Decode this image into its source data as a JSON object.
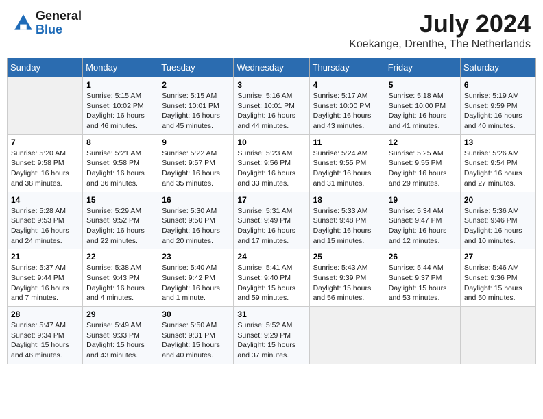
{
  "header": {
    "logo_general": "General",
    "logo_blue": "Blue",
    "month_title": "July 2024",
    "location": "Koekange, Drenthe, The Netherlands"
  },
  "weekdays": [
    "Sunday",
    "Monday",
    "Tuesday",
    "Wednesday",
    "Thursday",
    "Friday",
    "Saturday"
  ],
  "weeks": [
    [
      {
        "day": "",
        "sunrise": "",
        "sunset": "",
        "daylight": ""
      },
      {
        "day": "1",
        "sunrise": "Sunrise: 5:15 AM",
        "sunset": "Sunset: 10:02 PM",
        "daylight": "Daylight: 16 hours and 46 minutes."
      },
      {
        "day": "2",
        "sunrise": "Sunrise: 5:15 AM",
        "sunset": "Sunset: 10:01 PM",
        "daylight": "Daylight: 16 hours and 45 minutes."
      },
      {
        "day": "3",
        "sunrise": "Sunrise: 5:16 AM",
        "sunset": "Sunset: 10:01 PM",
        "daylight": "Daylight: 16 hours and 44 minutes."
      },
      {
        "day": "4",
        "sunrise": "Sunrise: 5:17 AM",
        "sunset": "Sunset: 10:00 PM",
        "daylight": "Daylight: 16 hours and 43 minutes."
      },
      {
        "day": "5",
        "sunrise": "Sunrise: 5:18 AM",
        "sunset": "Sunset: 10:00 PM",
        "daylight": "Daylight: 16 hours and 41 minutes."
      },
      {
        "day": "6",
        "sunrise": "Sunrise: 5:19 AM",
        "sunset": "Sunset: 9:59 PM",
        "daylight": "Daylight: 16 hours and 40 minutes."
      }
    ],
    [
      {
        "day": "7",
        "sunrise": "Sunrise: 5:20 AM",
        "sunset": "Sunset: 9:58 PM",
        "daylight": "Daylight: 16 hours and 38 minutes."
      },
      {
        "day": "8",
        "sunrise": "Sunrise: 5:21 AM",
        "sunset": "Sunset: 9:58 PM",
        "daylight": "Daylight: 16 hours and 36 minutes."
      },
      {
        "day": "9",
        "sunrise": "Sunrise: 5:22 AM",
        "sunset": "Sunset: 9:57 PM",
        "daylight": "Daylight: 16 hours and 35 minutes."
      },
      {
        "day": "10",
        "sunrise": "Sunrise: 5:23 AM",
        "sunset": "Sunset: 9:56 PM",
        "daylight": "Daylight: 16 hours and 33 minutes."
      },
      {
        "day": "11",
        "sunrise": "Sunrise: 5:24 AM",
        "sunset": "Sunset: 9:55 PM",
        "daylight": "Daylight: 16 hours and 31 minutes."
      },
      {
        "day": "12",
        "sunrise": "Sunrise: 5:25 AM",
        "sunset": "Sunset: 9:55 PM",
        "daylight": "Daylight: 16 hours and 29 minutes."
      },
      {
        "day": "13",
        "sunrise": "Sunrise: 5:26 AM",
        "sunset": "Sunset: 9:54 PM",
        "daylight": "Daylight: 16 hours and 27 minutes."
      }
    ],
    [
      {
        "day": "14",
        "sunrise": "Sunrise: 5:28 AM",
        "sunset": "Sunset: 9:53 PM",
        "daylight": "Daylight: 16 hours and 24 minutes."
      },
      {
        "day": "15",
        "sunrise": "Sunrise: 5:29 AM",
        "sunset": "Sunset: 9:52 PM",
        "daylight": "Daylight: 16 hours and 22 minutes."
      },
      {
        "day": "16",
        "sunrise": "Sunrise: 5:30 AM",
        "sunset": "Sunset: 9:50 PM",
        "daylight": "Daylight: 16 hours and 20 minutes."
      },
      {
        "day": "17",
        "sunrise": "Sunrise: 5:31 AM",
        "sunset": "Sunset: 9:49 PM",
        "daylight": "Daylight: 16 hours and 17 minutes."
      },
      {
        "day": "18",
        "sunrise": "Sunrise: 5:33 AM",
        "sunset": "Sunset: 9:48 PM",
        "daylight": "Daylight: 16 hours and 15 minutes."
      },
      {
        "day": "19",
        "sunrise": "Sunrise: 5:34 AM",
        "sunset": "Sunset: 9:47 PM",
        "daylight": "Daylight: 16 hours and 12 minutes."
      },
      {
        "day": "20",
        "sunrise": "Sunrise: 5:36 AM",
        "sunset": "Sunset: 9:46 PM",
        "daylight": "Daylight: 16 hours and 10 minutes."
      }
    ],
    [
      {
        "day": "21",
        "sunrise": "Sunrise: 5:37 AM",
        "sunset": "Sunset: 9:44 PM",
        "daylight": "Daylight: 16 hours and 7 minutes."
      },
      {
        "day": "22",
        "sunrise": "Sunrise: 5:38 AM",
        "sunset": "Sunset: 9:43 PM",
        "daylight": "Daylight: 16 hours and 4 minutes."
      },
      {
        "day": "23",
        "sunrise": "Sunrise: 5:40 AM",
        "sunset": "Sunset: 9:42 PM",
        "daylight": "Daylight: 16 hours and 1 minute."
      },
      {
        "day": "24",
        "sunrise": "Sunrise: 5:41 AM",
        "sunset": "Sunset: 9:40 PM",
        "daylight": "Daylight: 15 hours and 59 minutes."
      },
      {
        "day": "25",
        "sunrise": "Sunrise: 5:43 AM",
        "sunset": "Sunset: 9:39 PM",
        "daylight": "Daylight: 15 hours and 56 minutes."
      },
      {
        "day": "26",
        "sunrise": "Sunrise: 5:44 AM",
        "sunset": "Sunset: 9:37 PM",
        "daylight": "Daylight: 15 hours and 53 minutes."
      },
      {
        "day": "27",
        "sunrise": "Sunrise: 5:46 AM",
        "sunset": "Sunset: 9:36 PM",
        "daylight": "Daylight: 15 hours and 50 minutes."
      }
    ],
    [
      {
        "day": "28",
        "sunrise": "Sunrise: 5:47 AM",
        "sunset": "Sunset: 9:34 PM",
        "daylight": "Daylight: 15 hours and 46 minutes."
      },
      {
        "day": "29",
        "sunrise": "Sunrise: 5:49 AM",
        "sunset": "Sunset: 9:33 PM",
        "daylight": "Daylight: 15 hours and 43 minutes."
      },
      {
        "day": "30",
        "sunrise": "Sunrise: 5:50 AM",
        "sunset": "Sunset: 9:31 PM",
        "daylight": "Daylight: 15 hours and 40 minutes."
      },
      {
        "day": "31",
        "sunrise": "Sunrise: 5:52 AM",
        "sunset": "Sunset: 9:29 PM",
        "daylight": "Daylight: 15 hours and 37 minutes."
      },
      {
        "day": "",
        "sunrise": "",
        "sunset": "",
        "daylight": ""
      },
      {
        "day": "",
        "sunrise": "",
        "sunset": "",
        "daylight": ""
      },
      {
        "day": "",
        "sunrise": "",
        "sunset": "",
        "daylight": ""
      }
    ]
  ]
}
